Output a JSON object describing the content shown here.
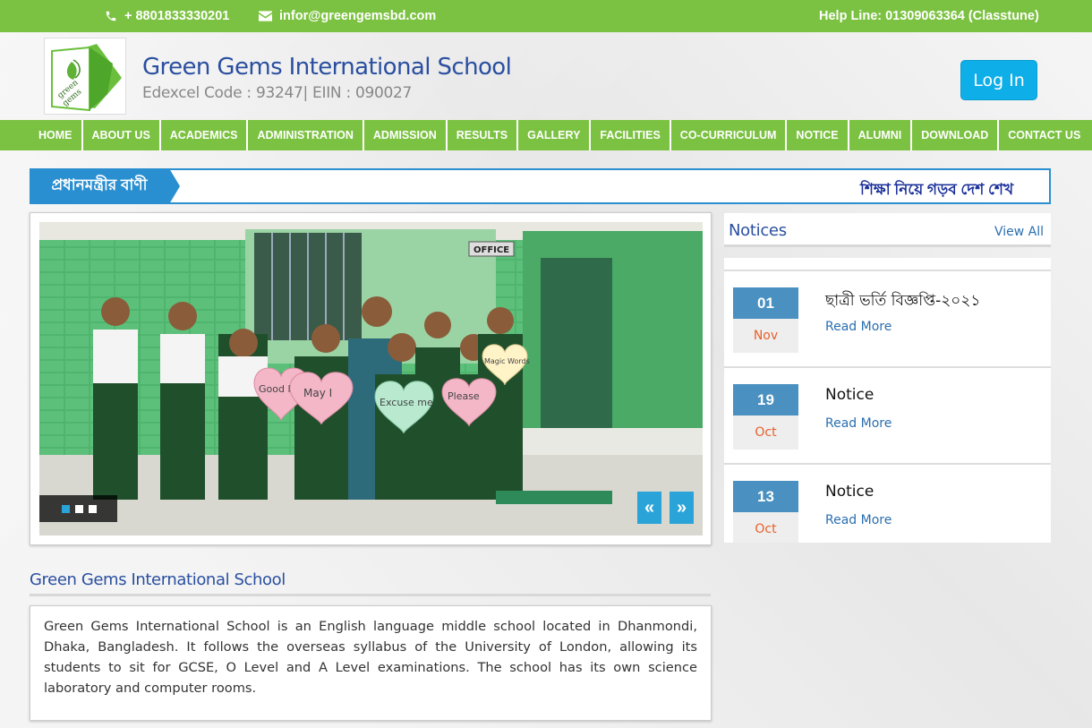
{
  "topbar": {
    "phone": "+ 8801833330201",
    "email": "infor@greengemsbd.com",
    "helpline": "Help Line:  01309063364 (Classtune)"
  },
  "header": {
    "logo_text": "green gems",
    "school_name": "Green Gems International School",
    "school_code": "Edexcel Code : 93247| EIIN : 090027",
    "login_label": "Log In"
  },
  "nav": {
    "items": [
      "HOME",
      "ABOUT US",
      "ACADEMICS",
      "ADMINISTRATION",
      "ADMISSION",
      "RESULTS",
      "GALLERY",
      "FACILITIES",
      "CO-CURRICULUM",
      "NOTICE",
      "ALUMNI",
      "DOWNLOAD",
      "CONTACT US"
    ]
  },
  "ticker": {
    "label": "প্রধানমন্ত্রীর বাণী",
    "text": "শিক্ষা নিয়ে গড়ব দেশ শেখ"
  },
  "slider": {
    "signs": [
      "Good Morning",
      "May I",
      "Excuse me",
      "Please",
      "Magic Words",
      "OFFICE"
    ],
    "prev_label": "«",
    "next_label": "»"
  },
  "about": {
    "title": "Green Gems International School",
    "body": "Green Gems International School is an English language middle school located in Dhanmondi, Dhaka, Bangladesh. It follows the overseas syllabus of the University of London, allowing its students to sit for GCSE, O Level and A Level examinations. The school has its own science laboratory and computer rooms."
  },
  "notices": {
    "title": "Notices",
    "view_all": "View All",
    "items": [
      {
        "day": "01",
        "month": "Nov",
        "title": "ছাত্রী ভর্তি বিজ্ঞপ্তি-২০২১",
        "read_more": "Read More"
      },
      {
        "day": "19",
        "month": "Oct",
        "title": "Notice",
        "read_more": "Read More"
      },
      {
        "day": "13",
        "month": "Oct",
        "title": "Notice",
        "read_more": "Read More"
      }
    ]
  }
}
